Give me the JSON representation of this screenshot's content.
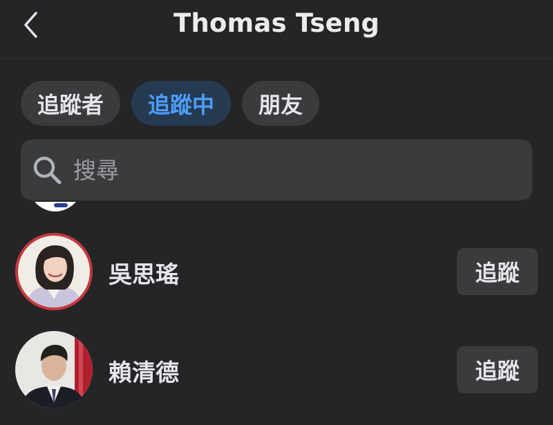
{
  "header": {
    "title": "Thomas Tseng"
  },
  "tabs": [
    {
      "label": "追蹤者",
      "active": false
    },
    {
      "label": "追蹤中",
      "active": true
    },
    {
      "label": "朋友",
      "active": false
    }
  ],
  "search": {
    "placeholder": "搜尋"
  },
  "people": [
    {
      "name": "吳思瑤",
      "action": "追蹤"
    },
    {
      "name": "賴清德",
      "action": "追蹤"
    }
  ],
  "colors": {
    "background": "#242526",
    "active_tab_text": "#4c9dfb",
    "active_tab_bg": "#263a52",
    "chip_bg": "#3a3b3c",
    "avatar_ring": "#c7383d"
  },
  "icons": {
    "back": "chevron-left-icon",
    "search": "search-icon"
  }
}
